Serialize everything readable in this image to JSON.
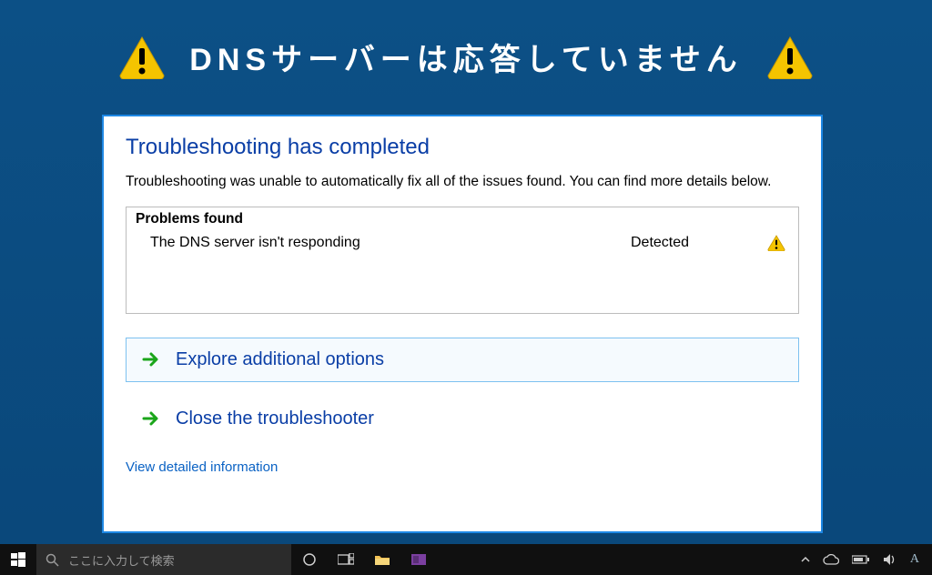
{
  "hero": {
    "title": "DNSサーバーは応答していません"
  },
  "dialog": {
    "title": "Troubleshooting has completed",
    "subtitle": "Troubleshooting was unable to automatically fix all of the issues found. You can find more details below.",
    "problems_header": "Problems found",
    "problems": [
      {
        "name": "The DNS server isn't responding",
        "status": "Detected"
      }
    ],
    "options": {
      "explore": "Explore additional options",
      "close": "Close the troubleshooter"
    },
    "detail_link": "View detailed information"
  },
  "taskbar": {
    "search_placeholder": "ここに入力して検索"
  }
}
